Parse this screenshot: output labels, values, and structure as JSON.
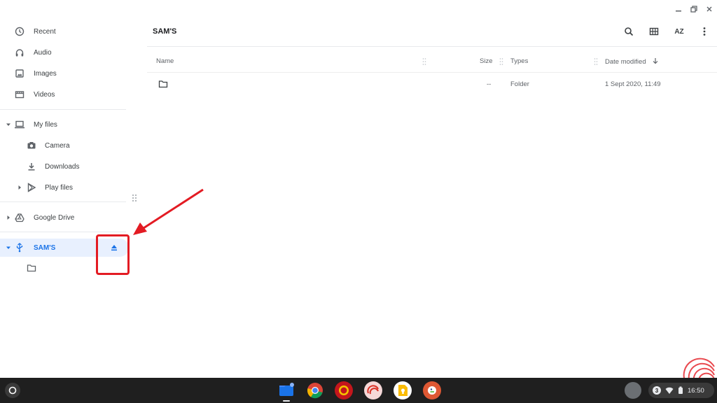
{
  "window": {
    "controls": [
      "minimize",
      "maximize",
      "close"
    ]
  },
  "sidebar": {
    "recent": "Recent",
    "audio": "Audio",
    "images": "Images",
    "videos": "Videos",
    "my_files": "My files",
    "camera": "Camera",
    "downloads": "Downloads",
    "play_files": "Play files",
    "google_drive": "Google Drive",
    "usb_drive": "SAM'S"
  },
  "main": {
    "title": "SAM'S",
    "columns": {
      "name": "Name",
      "size": "Size",
      "types": "Types",
      "date_modified": "Date modified"
    },
    "rows": [
      {
        "name": "",
        "size": "--",
        "type": "Folder",
        "date": "1 Sept 2020, 11:49"
      }
    ],
    "toolbar": {
      "sort_label": "AZ"
    }
  },
  "shelf": {
    "notification_count": "3",
    "time": "16:50"
  },
  "colors": {
    "accent": "#1a73e8",
    "highlight": "#e31b23",
    "active_bg": "#e8f0fe",
    "shelf": "#1f1f1f"
  }
}
